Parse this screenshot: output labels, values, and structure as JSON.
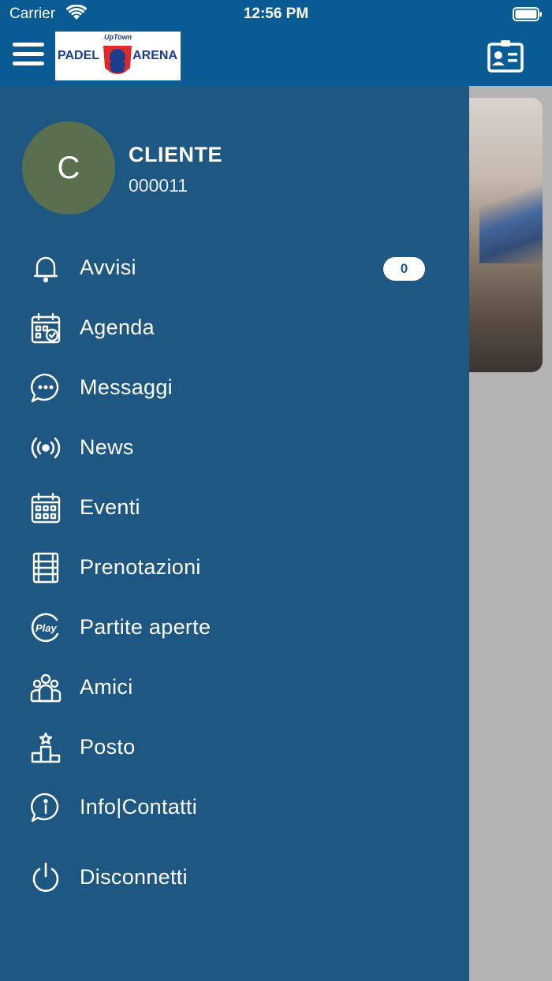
{
  "status_bar": {
    "carrier": "Carrier",
    "time": "12:56 PM"
  },
  "header": {
    "logo": {
      "top_text": "UpTown",
      "left_text": "PADEL",
      "right_text": "ARENA"
    }
  },
  "user": {
    "initial": "C",
    "name": "CLIENTE",
    "code": "000011"
  },
  "menu": [
    {
      "label": "Avvisi",
      "icon": "bell-icon",
      "badge": "0"
    },
    {
      "label": "Agenda",
      "icon": "calendar-check-icon"
    },
    {
      "label": "Messaggi",
      "icon": "chat-bubble-icon"
    },
    {
      "label": "News",
      "icon": "broadcast-icon"
    },
    {
      "label": "Eventi",
      "icon": "calendar-grid-icon"
    },
    {
      "label": "Prenotazioni",
      "icon": "court-icon"
    },
    {
      "label": "Partite aperte",
      "icon": "play-icon"
    },
    {
      "label": "Amici",
      "icon": "friends-icon"
    },
    {
      "label": "Posto",
      "icon": "podium-icon"
    },
    {
      "label": "Info|Contatti",
      "icon": "info-chat-icon"
    },
    {
      "label": "Disconnetti",
      "icon": "power-icon"
    }
  ],
  "colors": {
    "header": "#0a5a94",
    "drawer": "#1d5782",
    "avatar": "#5a6f4e"
  }
}
